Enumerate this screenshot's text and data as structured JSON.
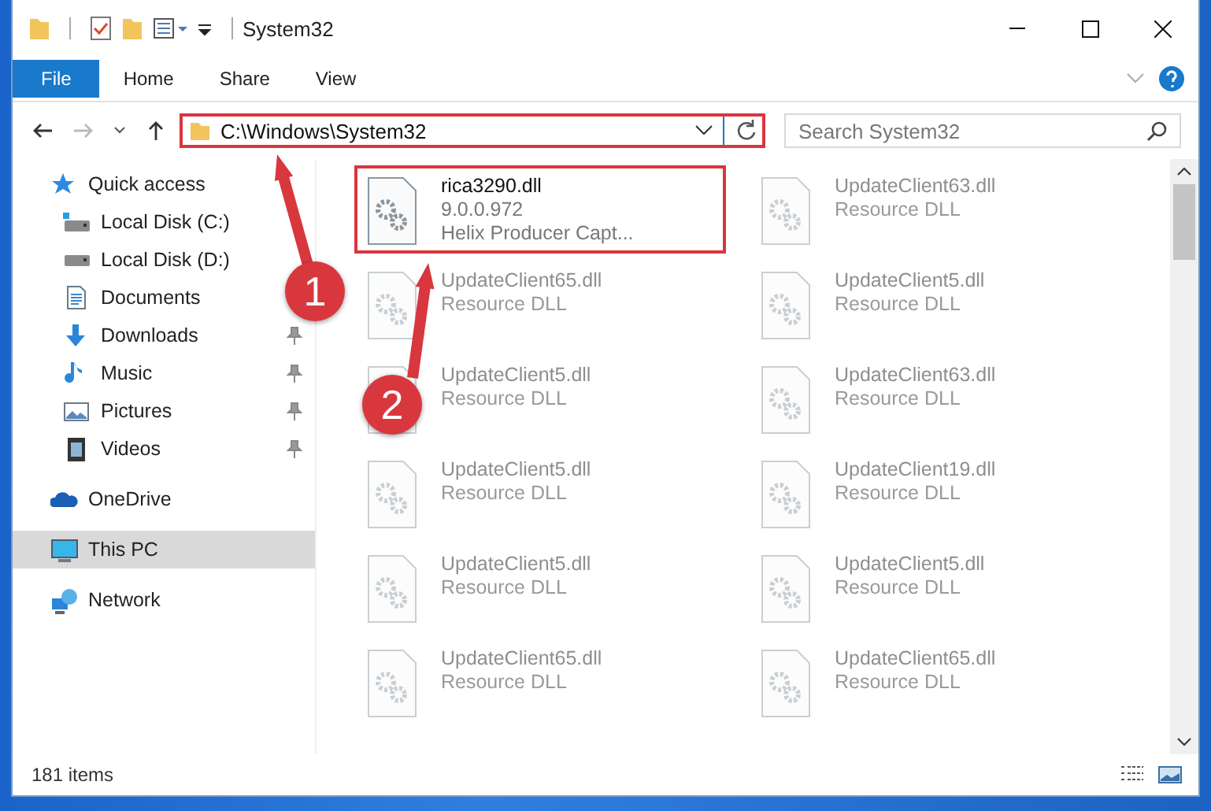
{
  "window": {
    "title": "System32"
  },
  "ribbon": {
    "tabs": [
      {
        "label": "File",
        "selected": true
      },
      {
        "label": "Home",
        "selected": false
      },
      {
        "label": "Share",
        "selected": false
      },
      {
        "label": "View",
        "selected": false
      }
    ]
  },
  "address_bar": {
    "path": "C:\\Windows\\System32",
    "highlighted": true
  },
  "search": {
    "placeholder": "Search System32"
  },
  "navigation": [
    {
      "label": "Quick access",
      "kind": "star",
      "selected": false,
      "children": [
        {
          "label": "Local Disk (C:)",
          "kind": "system-drive",
          "pinned": false
        },
        {
          "label": "Local Disk (D:)",
          "kind": "drive",
          "pinned": false
        },
        {
          "label": "Documents",
          "kind": "documents",
          "pinned": false
        },
        {
          "label": "Downloads",
          "kind": "downloads",
          "pinned": true
        },
        {
          "label": "Music",
          "kind": "music",
          "pinned": true
        },
        {
          "label": "Pictures",
          "kind": "pictures",
          "pinned": true
        },
        {
          "label": "Videos",
          "kind": "videos",
          "pinned": true
        }
      ]
    },
    {
      "label": "OneDrive",
      "kind": "cloud",
      "selected": false
    },
    {
      "label": "This PC",
      "kind": "computer",
      "selected": true
    },
    {
      "label": "Network",
      "kind": "network",
      "selected": false
    }
  ],
  "files": [
    {
      "name": "rica3290.dll",
      "lines": [
        "9.0.0.972",
        "Helix Producer Capt..."
      ],
      "highlighted": true,
      "faded": false
    },
    {
      "name": "UpdateClient63.dll",
      "lines": [
        "Resource DLL"
      ],
      "highlighted": false,
      "faded": true
    },
    {
      "name": "UpdateClient65.dll",
      "lines": [
        "Resource DLL"
      ],
      "highlighted": false,
      "faded": true
    },
    {
      "name": "UpdateClient5.dll",
      "lines": [
        "Resource DLL"
      ],
      "highlighted": false,
      "faded": true
    },
    {
      "name": "UpdateClient5.dll",
      "lines": [
        "Resource DLL"
      ],
      "highlighted": false,
      "faded": true
    },
    {
      "name": "UpdateClient63.dll",
      "lines": [
        "Resource DLL"
      ],
      "highlighted": false,
      "faded": true
    },
    {
      "name": "UpdateClient5.dll",
      "lines": [
        "Resource DLL"
      ],
      "highlighted": false,
      "faded": true
    },
    {
      "name": "UpdateClient19.dll",
      "lines": [
        "Resource DLL"
      ],
      "highlighted": false,
      "faded": true
    },
    {
      "name": "UpdateClient5.dll",
      "lines": [
        "Resource DLL"
      ],
      "highlighted": false,
      "faded": true
    },
    {
      "name": "UpdateClient5.dll",
      "lines": [
        "Resource DLL"
      ],
      "highlighted": false,
      "faded": true
    },
    {
      "name": "UpdateClient65.dll",
      "lines": [
        "Resource DLL"
      ],
      "highlighted": false,
      "faded": true
    },
    {
      "name": "UpdateClient65.dll",
      "lines": [
        "Resource DLL"
      ],
      "highlighted": false,
      "faded": true
    }
  ],
  "status_bar": {
    "item_count": "181 items"
  },
  "annotations": [
    {
      "number": "1"
    },
    {
      "number": "2"
    }
  ]
}
